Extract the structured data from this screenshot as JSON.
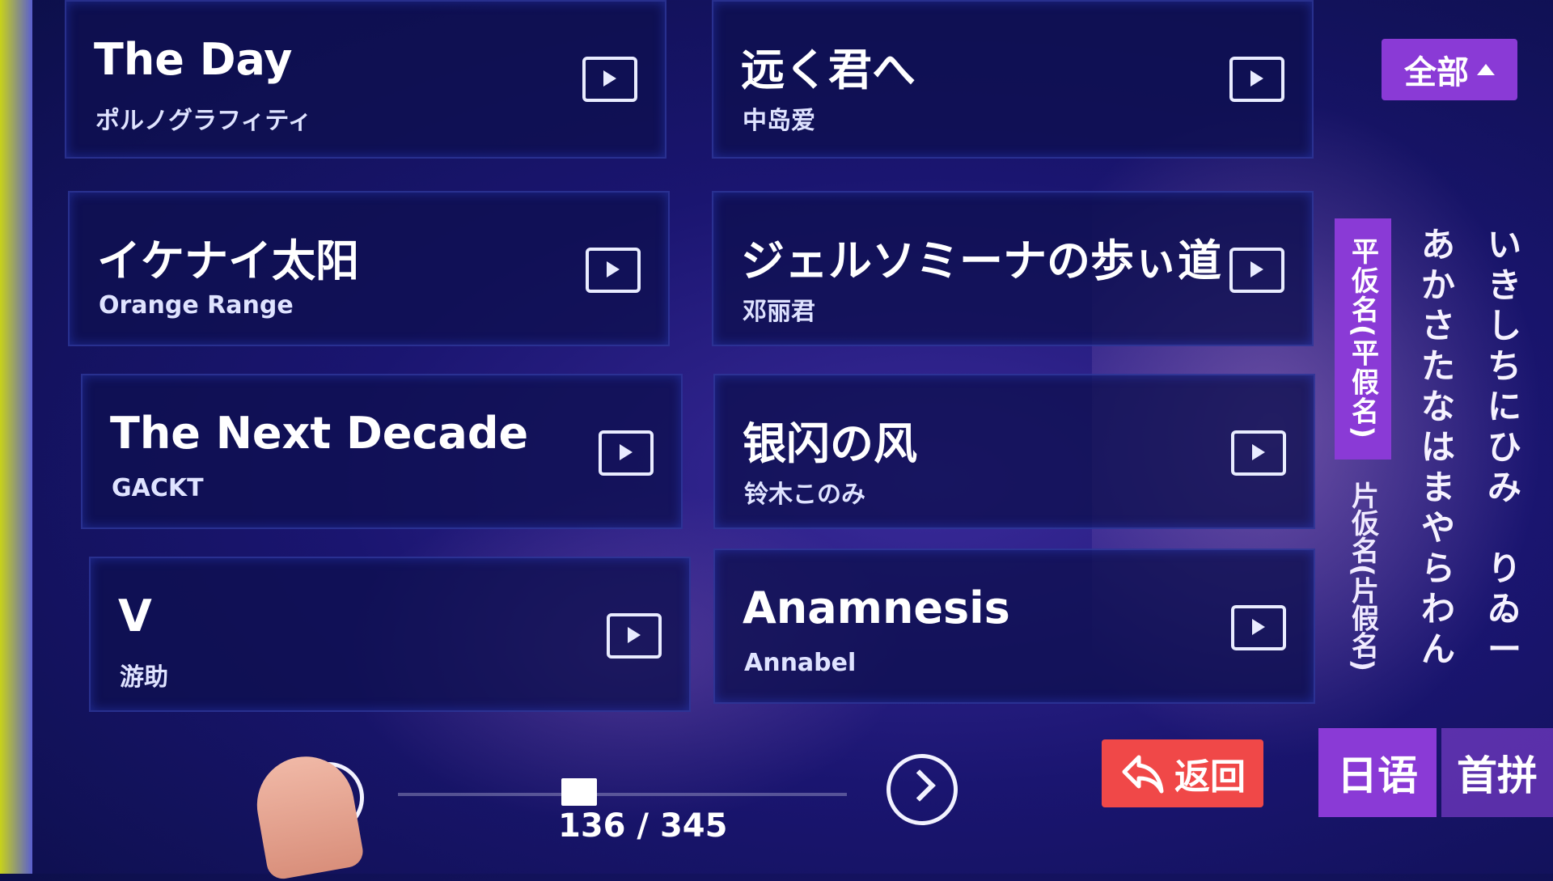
{
  "songs": [
    {
      "title": "The Day",
      "artist": "ポルノグラフィティ"
    },
    {
      "title": "远く君へ",
      "artist": "中岛爱"
    },
    {
      "title": "イケナイ太阳",
      "artist": "Orange Range"
    },
    {
      "title": "ジェルソミーナの歩ぃ道",
      "artist": "邓丽君"
    },
    {
      "title": "The Next Decade",
      "artist": "GACKT"
    },
    {
      "title": "银闪の风",
      "artist": "铃木このみ"
    },
    {
      "title": "V",
      "artist": "游助"
    },
    {
      "title": "Anamnesis",
      "artist": "Annabel"
    }
  ],
  "filter": {
    "label": "全部"
  },
  "kana": {
    "hiragana_tab": "平仮名(平假名)",
    "katakana_tab": "片仮名(片假名)",
    "column1": [
      "あ",
      "か",
      "さ",
      "た",
      "な",
      "は",
      "ま",
      "や",
      "ら",
      "わ",
      "ん"
    ],
    "column2": [
      "い",
      "き",
      "し",
      "ち",
      "に",
      "ひ",
      "み",
      "",
      "り",
      "ゐ",
      "ー"
    ]
  },
  "language_tabs": {
    "japanese": "日语",
    "pinyin": "首拼"
  },
  "back_button": {
    "label": "返回"
  },
  "pagination": {
    "text": "136 / 345",
    "current": 136,
    "total": 345
  },
  "icons": {
    "play": "play-video-icon",
    "back": "undo-arrow-icon",
    "next": "chevron-right-icon",
    "prev": "chevron-left-icon"
  }
}
